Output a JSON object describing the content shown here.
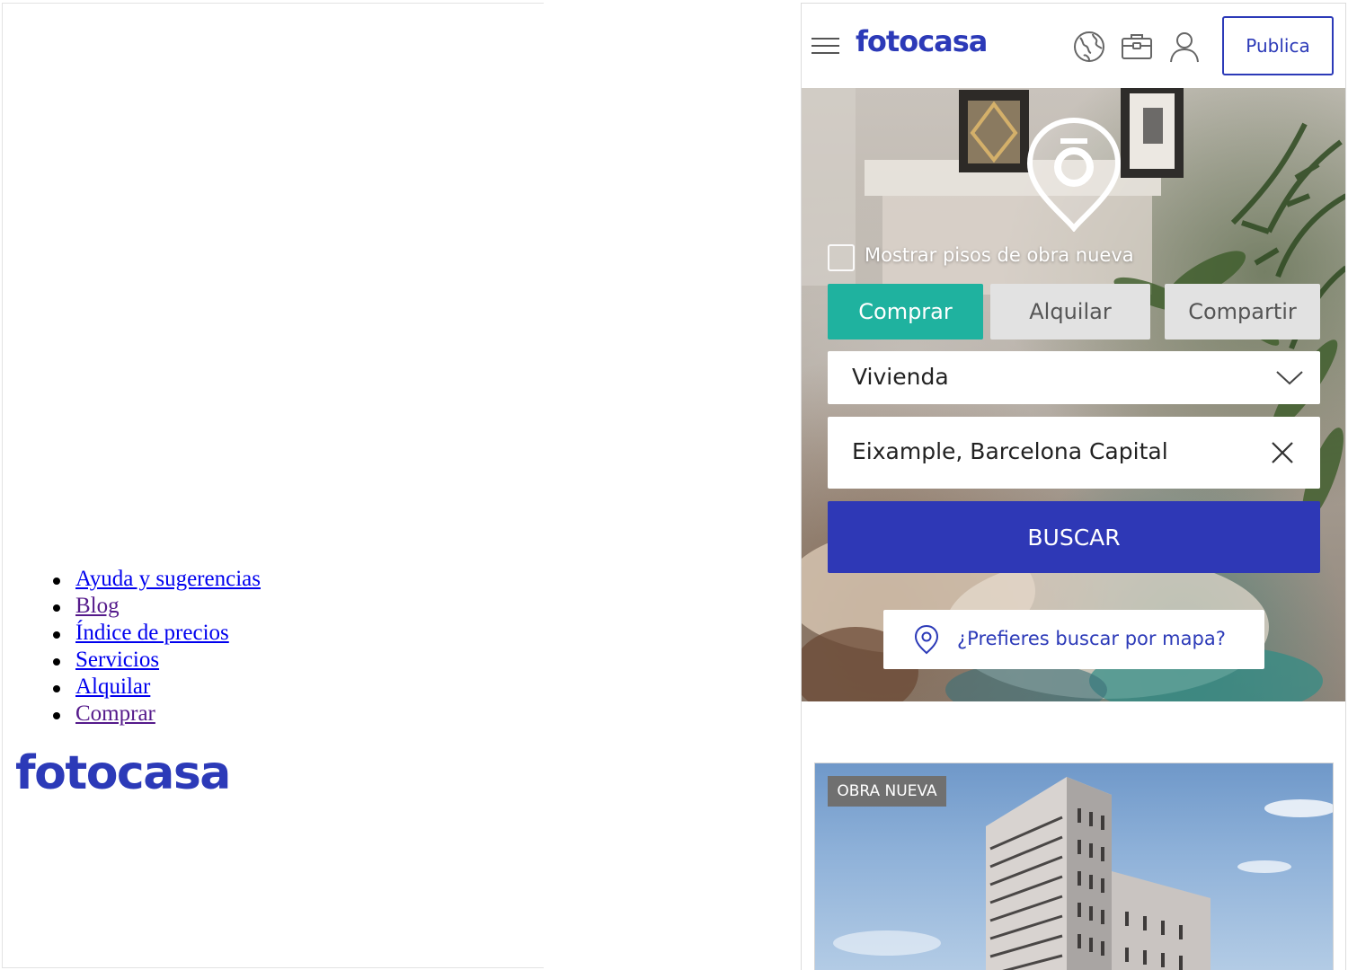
{
  "left_panel": {
    "footer_links": [
      "Ayuda y sugerencias",
      "Blog",
      "Índice de precios",
      "Servicios",
      "Alquilar",
      "Comprar"
    ],
    "logo_text": "fotocasa"
  },
  "header": {
    "logo_text": "fotocasa",
    "publish_button": "Publica",
    "icons": [
      "menu-icon",
      "globe-icon",
      "briefcase-icon",
      "user-icon"
    ]
  },
  "search": {
    "new_build_label": "Mostrar pisos de obra nueva",
    "tabs": [
      "Comprar",
      "Alquilar",
      "Compartir"
    ],
    "active_tab": "Comprar",
    "property_type": "Vivienda",
    "location_value": "Eixample, Barcelona Capital",
    "search_button": "BUSCAR",
    "map_search_label": "¿Prefieres buscar por mapa?"
  },
  "listing": {
    "badge": "OBRA NUEVA"
  },
  "colors": {
    "brand_blue": "#2c3ab8",
    "teal_active": "#1fb29f",
    "search_button_blue": "#2e38b6",
    "inactive_tab": "#e2e2e2"
  }
}
